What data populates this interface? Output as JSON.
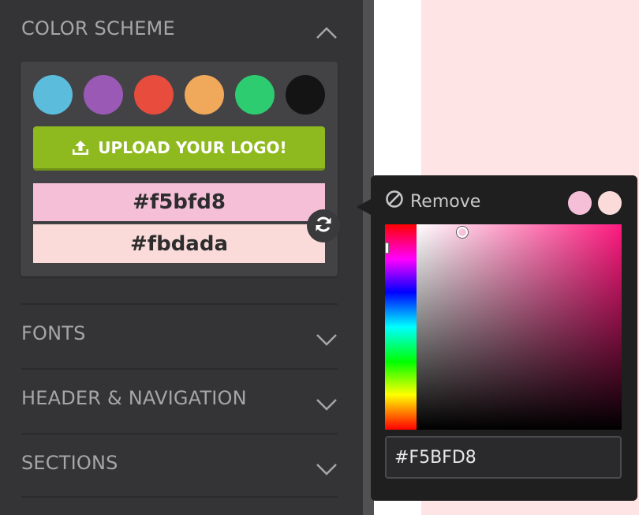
{
  "sidebar": {
    "color_scheme": {
      "title": "COLOR SCHEME",
      "swatches": [
        {
          "name": "blue",
          "color": "#5bbcdc"
        },
        {
          "name": "purple",
          "color": "#9b59b6"
        },
        {
          "name": "red",
          "color": "#e74c3c"
        },
        {
          "name": "orange",
          "color": "#f0a95a"
        },
        {
          "name": "green",
          "color": "#2ecc71"
        },
        {
          "name": "black",
          "color": "#141414"
        }
      ],
      "upload_label": "UPLOAD YOUR LOGO!",
      "primary_color": "#f5bfd8",
      "secondary_color": "#fbdada"
    },
    "sections": [
      {
        "title": "FONTS"
      },
      {
        "title": "HEADER & NAVIGATION"
      },
      {
        "title": "SECTIONS"
      }
    ]
  },
  "picker": {
    "remove_label": "Remove",
    "current_swatch": "#f5bfd8",
    "alt_swatch": "#fbdada",
    "hex_value": "#F5BFD8"
  },
  "canvas": {
    "background_color": "#ffe4e6"
  }
}
